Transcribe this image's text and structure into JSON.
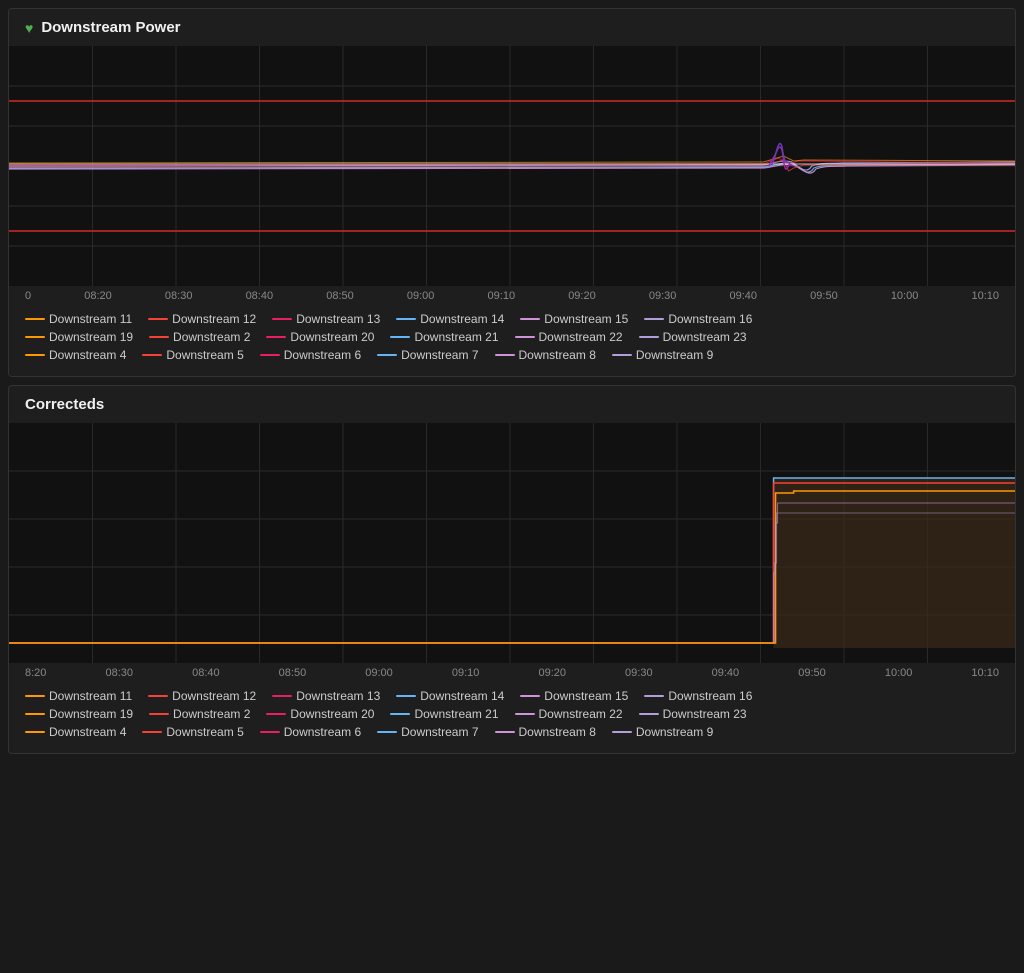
{
  "chart1": {
    "title": "Downstream Power",
    "timeLabels": [
      "08:20",
      "08:30",
      "08:40",
      "08:50",
      "09:00",
      "09:10",
      "09:20",
      "09:30",
      "09:40",
      "09:50",
      "10:00",
      "10:10"
    ],
    "legendRows": [
      [
        {
          "label": "Downstream 11",
          "color": "#ff9800"
        },
        {
          "label": "Downstream 12",
          "color": "#f44336"
        },
        {
          "label": "Downstream 13",
          "color": "#e91e63"
        },
        {
          "label": "Downstream 14",
          "color": "#64b5f6"
        },
        {
          "label": "Downstream 15",
          "color": "#ce93d8"
        },
        {
          "label": "Downstream 16",
          "color": "#b39ddb"
        }
      ],
      [
        {
          "label": "Downstream 19",
          "color": "#ff9800"
        },
        {
          "label": "Downstream 2",
          "color": "#f44336"
        },
        {
          "label": "Downstream 20",
          "color": "#e91e63"
        },
        {
          "label": "Downstream 21",
          "color": "#64b5f6"
        },
        {
          "label": "Downstream 22",
          "color": "#ce93d8"
        },
        {
          "label": "Downstream 23",
          "color": "#b39ddb"
        }
      ],
      [
        {
          "label": "Downstream 4",
          "color": "#ff9800"
        },
        {
          "label": "Downstream 5",
          "color": "#f44336"
        },
        {
          "label": "Downstream 6",
          "color": "#e91e63"
        },
        {
          "label": "Downstream 7",
          "color": "#64b5f6"
        },
        {
          "label": "Downstream 8",
          "color": "#ce93d8"
        },
        {
          "label": "Downstream 9",
          "color": "#b39ddb"
        }
      ]
    ]
  },
  "chart2": {
    "title": "Correcteds",
    "timeLabels": [
      "08:20",
      "08:30",
      "08:40",
      "08:50",
      "09:00",
      "09:10",
      "09:20",
      "09:30",
      "09:40",
      "09:50",
      "10:00",
      "10:10"
    ],
    "legendRows": [
      [
        {
          "label": "Downstream 11",
          "color": "#ff9800"
        },
        {
          "label": "Downstream 12",
          "color": "#f44336"
        },
        {
          "label": "Downstream 13",
          "color": "#e91e63"
        },
        {
          "label": "Downstream 14",
          "color": "#64b5f6"
        },
        {
          "label": "Downstream 15",
          "color": "#ce93d8"
        },
        {
          "label": "Downstream 16",
          "color": "#b39ddb"
        }
      ],
      [
        {
          "label": "Downstream 19",
          "color": "#ff9800"
        },
        {
          "label": "Downstream 2",
          "color": "#f44336"
        },
        {
          "label": "Downstream 20",
          "color": "#e91e63"
        },
        {
          "label": "Downstream 21",
          "color": "#64b5f6"
        },
        {
          "label": "Downstream 22",
          "color": "#ce93d8"
        },
        {
          "label": "Downstream 23",
          "color": "#b39ddb"
        }
      ],
      [
        {
          "label": "Downstream 4",
          "color": "#ff9800"
        },
        {
          "label": "Downstream 5",
          "color": "#f44336"
        },
        {
          "label": "Downstream 6",
          "color": "#e91e63"
        },
        {
          "label": "Downstream 7",
          "color": "#64b5f6"
        },
        {
          "label": "Downstream 8",
          "color": "#ce93d8"
        },
        {
          "label": "Downstream 9",
          "color": "#b39ddb"
        }
      ]
    ]
  }
}
